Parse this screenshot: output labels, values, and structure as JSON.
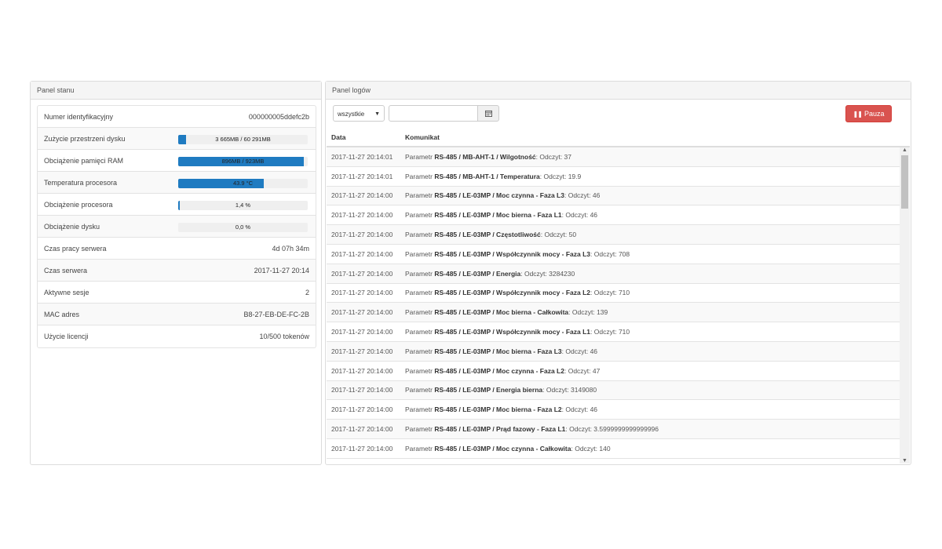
{
  "status_panel": {
    "title": "Panel stanu",
    "rows": [
      {
        "label": "Numer identyfikacyjny",
        "value": "000000005ddefc2b"
      },
      {
        "label": "Zużycie przestrzeni dysku",
        "bar_text": "3 665MB / 60 291MB",
        "progress": 0.061
      },
      {
        "label": "Obciążenie pamięci RAM",
        "bar_text": "896MB / 923MB",
        "progress": 0.97
      },
      {
        "label": "Temperatura procesora",
        "bar_text": "43.9 °C",
        "progress": 0.66
      },
      {
        "label": "Obciążenie procesora",
        "bar_text": "1,4 %",
        "progress": 0.014
      },
      {
        "label": "Obciążenie dysku",
        "bar_text": "0,0 %",
        "progress": 0.0
      },
      {
        "label": "Czas pracy serwera",
        "value": "4d 07h 34m"
      },
      {
        "label": "Czas serwera",
        "value": "2017-11-27 20:14"
      },
      {
        "label": "Aktywne sesje",
        "value": "2"
      },
      {
        "label": "MAC adres",
        "value": "B8-27-EB-DE-FC-2B"
      },
      {
        "label": "Użycie licencji",
        "value": "10/500 tokenów"
      }
    ]
  },
  "log_panel": {
    "title": "Panel logów",
    "filter_select": "wszystkie",
    "date_input": "",
    "pause_label": "Pauza",
    "colors": {
      "pause": "#d9534f",
      "progress": "#1f7bc1"
    },
    "columns": {
      "date": "Data",
      "message": "Komunikat"
    },
    "rows": [
      {
        "date": "2017-11-27 20:14:01",
        "prefix": "Parametr ",
        "param": "RS-485 / MB-AHT-1 / Wilgotność",
        "suffix": ": Odczyt: 37"
      },
      {
        "date": "2017-11-27 20:14:01",
        "prefix": "Parametr ",
        "param": "RS-485 / MB-AHT-1 / Temperatura",
        "suffix": ": Odczyt: 19.9"
      },
      {
        "date": "2017-11-27 20:14:00",
        "prefix": "Parametr ",
        "param": "RS-485 / LE-03MP / Moc czynna - Faza L3",
        "suffix": ": Odczyt: 46"
      },
      {
        "date": "2017-11-27 20:14:00",
        "prefix": "Parametr ",
        "param": "RS-485 / LE-03MP / Moc bierna - Faza L1",
        "suffix": ": Odczyt: 46"
      },
      {
        "date": "2017-11-27 20:14:00",
        "prefix": "Parametr ",
        "param": "RS-485 / LE-03MP / Częstotliwość",
        "suffix": ": Odczyt: 50"
      },
      {
        "date": "2017-11-27 20:14:00",
        "prefix": "Parametr ",
        "param": "RS-485 / LE-03MP / Współczynnik mocy - Faza L3",
        "suffix": ": Odczyt: 708"
      },
      {
        "date": "2017-11-27 20:14:00",
        "prefix": "Parametr ",
        "param": "RS-485 / LE-03MP / Energia",
        "suffix": ": Odczyt: 3284230"
      },
      {
        "date": "2017-11-27 20:14:00",
        "prefix": "Parametr ",
        "param": "RS-485 / LE-03MP / Współczynnik mocy - Faza L2",
        "suffix": ": Odczyt: 710"
      },
      {
        "date": "2017-11-27 20:14:00",
        "prefix": "Parametr ",
        "param": "RS-485 / LE-03MP / Moc bierna - Całkowita",
        "suffix": ": Odczyt: 139"
      },
      {
        "date": "2017-11-27 20:14:00",
        "prefix": "Parametr ",
        "param": "RS-485 / LE-03MP / Współczynnik mocy - Faza L1",
        "suffix": ": Odczyt: 710"
      },
      {
        "date": "2017-11-27 20:14:00",
        "prefix": "Parametr ",
        "param": "RS-485 / LE-03MP / Moc bierna - Faza L3",
        "suffix": ": Odczyt: 46"
      },
      {
        "date": "2017-11-27 20:14:00",
        "prefix": "Parametr ",
        "param": "RS-485 / LE-03MP / Moc czynna - Faza L2",
        "suffix": ": Odczyt: 47"
      },
      {
        "date": "2017-11-27 20:14:00",
        "prefix": "Parametr ",
        "param": "RS-485 / LE-03MP / Energia bierna",
        "suffix": ": Odczyt: 3149080"
      },
      {
        "date": "2017-11-27 20:14:00",
        "prefix": "Parametr ",
        "param": "RS-485 / LE-03MP / Moc bierna - Faza L2",
        "suffix": ": Odczyt: 46"
      },
      {
        "date": "2017-11-27 20:14:00",
        "prefix": "Parametr ",
        "param": "RS-485 / LE-03MP / Prąd fazowy - Faza L1",
        "suffix": ": Odczyt: 3.5999999999999996"
      },
      {
        "date": "2017-11-27 20:14:00",
        "prefix": "Parametr ",
        "param": "RS-485 / LE-03MP / Moc czynna - Całkowita",
        "suffix": ": Odczyt: 140"
      }
    ]
  }
}
